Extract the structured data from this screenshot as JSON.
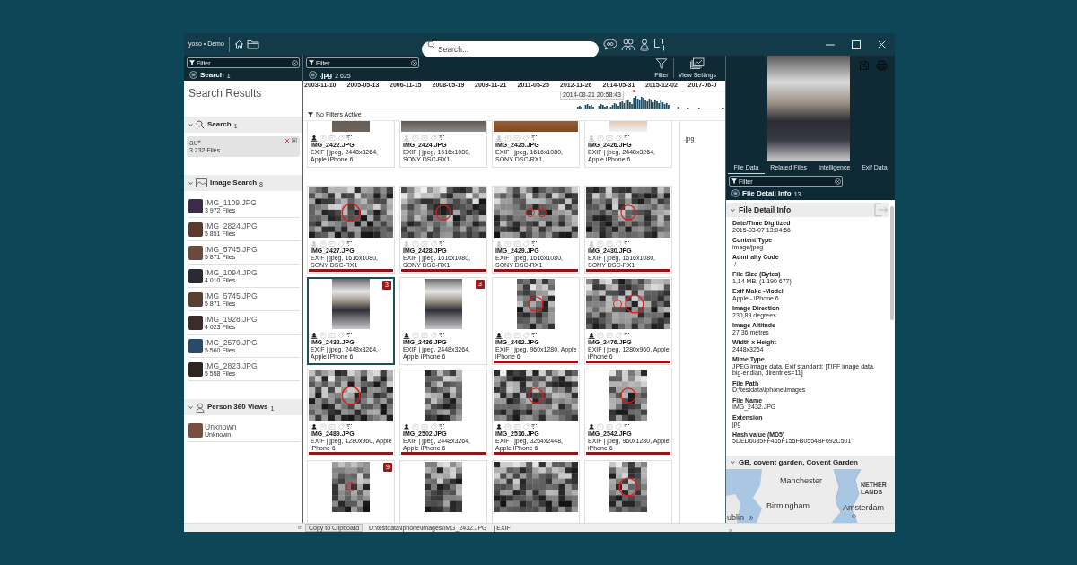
{
  "window": {
    "logo": "yoso • Demo",
    "search_placeholder": "Search..."
  },
  "search_panel": {
    "filter_placeholder": "Filter",
    "header": {
      "title": "Search",
      "count": "1"
    },
    "heading": "Search Results",
    "sections": [
      {
        "kind": "search",
        "title": "Search",
        "count": "1",
        "expanded": true,
        "items": [
          {
            "title": "au*",
            "subtitle": "3 232 Files",
            "selected": true
          }
        ]
      },
      {
        "kind": "image",
        "title": "Image Search",
        "count": "8",
        "expanded": true,
        "items": [
          {
            "title": "IMG_1109.JPG",
            "subtitle": "3 972 Files",
            "selected": false
          },
          {
            "title": "IMG_2824.JPG",
            "subtitle": "5 851 Files",
            "selected": false
          },
          {
            "title": "IMG_5745.JPG",
            "subtitle": "5 871 Files",
            "selected": false
          },
          {
            "title": "IMG_1094.JPG",
            "subtitle": "4 010 Files",
            "selected": false
          },
          {
            "title": "IMG_5745.JPG",
            "subtitle": "5 871 Files",
            "selected": false
          },
          {
            "title": "IMG_1928.JPG",
            "subtitle": "4 023 Files",
            "selected": false
          },
          {
            "title": "IMG_2579.JPG",
            "subtitle": "5 560 Files",
            "selected": false
          },
          {
            "title": "IMG_2823.JPG",
            "subtitle": "5 558 Files",
            "selected": false
          }
        ]
      },
      {
        "kind": "person",
        "title": "Person 360 Views",
        "count": "1",
        "expanded": true,
        "items": [
          {
            "title": "Unknown",
            "subtitle": "Unknown",
            "selected": false
          }
        ]
      }
    ]
  },
  "results_panel": {
    "filter_placeholder": "Filter",
    "header": {
      "title": ".jpg",
      "count": "2 625"
    },
    "tools": [
      {
        "kind": "filter",
        "label": "Filter"
      },
      {
        "kind": "view_settings",
        "label": "View Settings"
      }
    ],
    "timeline": {
      "dates": [
        "2003-11-10",
        "2005-05-13",
        "2006-11-15",
        "2008-05-19",
        "2009-11-21",
        "2011-05-25",
        "2012-11-26",
        "2014-05-31",
        "2015-12-02",
        "2017-06-0"
      ],
      "tooltip": "2014-08-21 20:58:43"
    },
    "filter_status": "No Filters Active",
    "cards": [
      {
        "name": "IMG_2422.JPG",
        "exif": "EXIF | jpeg, 2448x3264, Apple iPhone 6",
        "kind": "photo",
        "person_tagged": true,
        "flagged": false,
        "selected": false
      },
      {
        "name": "IMG_2424.JPG",
        "exif": "EXIF | jpeg, 1616x1080, SONY DSC-RX1",
        "kind": "photo",
        "person_tagged": false,
        "flagged": false,
        "selected": false
      },
      {
        "name": "IMG_2425.JPG",
        "exif": "EXIF | jpeg, 1616x1080, SONY DSC-RX1",
        "kind": "photo",
        "person_tagged": false,
        "flagged": false,
        "selected": false
      },
      {
        "name": "IMG_2426.JPG",
        "exif": "EXIF | jpeg, 2448x3264, Apple iPhone 6",
        "kind": "photo",
        "person_tagged": false,
        "flagged": false,
        "selected": false
      },
      {
        "name": "IMG_2427.JPG",
        "exif": "EXIF | jpeg, 1616x1080, SONY DSC-RX1",
        "kind": "pixelated",
        "person_tagged": false,
        "flagged": true,
        "selected": false,
        "faces": [
          {
            "kind": "large"
          }
        ]
      },
      {
        "name": "IMG_2428.JPG",
        "exif": "EXIF | jpeg, 1616x1080, SONY DSC-RX1",
        "kind": "pixelated",
        "person_tagged": false,
        "flagged": true,
        "selected": false,
        "faces": [
          {
            "kind": "medium"
          }
        ]
      },
      {
        "name": "IMG_2429.JPG",
        "exif": "EXIF | jpeg, 1616x1080, SONY DSC-RX1",
        "kind": "pixelated",
        "person_tagged": false,
        "flagged": true,
        "selected": false,
        "faces": [
          {
            "kind": "small"
          },
          {
            "kind": "small"
          }
        ]
      },
      {
        "name": "IMG_2430.JPG",
        "exif": "EXIF | jpeg, 1616x1080, SONY DSC-RX1",
        "kind": "pixelated",
        "person_tagged": false,
        "flagged": true,
        "selected": false,
        "faces": [
          {
            "kind": "medium"
          }
        ]
      },
      {
        "name": "IMG_2432.JPG",
        "exif": "EXIF | jpeg, 2448x3264, Apple iPhone 6",
        "kind": "photo",
        "person_tagged": true,
        "flagged": false,
        "selected": true,
        "badge": "3"
      },
      {
        "name": "IMG_2436.JPG",
        "exif": "EXIF | jpeg, 2448x3264, Apple iPhone 6",
        "kind": "photo",
        "person_tagged": true,
        "flagged": false,
        "selected": false,
        "badge": "3"
      },
      {
        "name": "IMG_2462.JPG",
        "exif": "EXIF | jpeg, 960x1280, Apple iPhone 6",
        "kind": "pixelated",
        "person_tagged": true,
        "flagged": true,
        "selected": false,
        "faces": [
          {
            "kind": "medium"
          }
        ]
      },
      {
        "name": "IMG_2476.JPG",
        "exif": "EXIF | jpeg, 1280x960, Apple iPhone 6",
        "kind": "pixelated",
        "person_tagged": true,
        "flagged": true,
        "selected": false,
        "faces": [
          {
            "kind": "small"
          },
          {
            "kind": "large"
          }
        ]
      },
      {
        "name": "IMG_2489.JPG",
        "exif": "EXIF | jpeg, 1280x960, Apple iPhone 6",
        "kind": "pixelated",
        "person_tagged": true,
        "flagged": true,
        "selected": false,
        "faces": [
          {
            "kind": "large"
          }
        ]
      },
      {
        "name": "IMG_2502.JPG",
        "exif": "EXIF | jpeg, 2448x3264, Apple iPhone 6",
        "kind": "pixelated",
        "person_tagged": true,
        "flagged": true,
        "selected": false
      },
      {
        "name": "IMG_2516.JPG",
        "exif": "EXIF | jpeg, 3264x2448, Apple iPhone 6",
        "kind": "pixelated",
        "person_tagged": true,
        "flagged": true,
        "selected": false,
        "faces": [
          {
            "kind": "medium"
          }
        ]
      },
      {
        "name": "IMG_2542.JPG",
        "exif": "EXIF | jpeg, 960x1280, Apple iPhone 6",
        "kind": "pixelated",
        "person_tagged": true,
        "flagged": true,
        "selected": false,
        "faces": [
          {
            "kind": "medium"
          }
        ]
      },
      {
        "kind": "pixelated",
        "selected": false,
        "badge": "9",
        "faces": [
          {
            "kind": "small"
          }
        ]
      },
      {
        "kind": "pixelated",
        "selected": false
      },
      {
        "kind": "pixelated",
        "selected": false
      },
      {
        "kind": "pixelated",
        "selected": false,
        "faces": [
          {
            "kind": "large"
          }
        ]
      }
    ],
    "side_group": ".jpg"
  },
  "detail_panel": {
    "tabs": [
      {
        "label": "File Data",
        "selected": true
      },
      {
        "label": "Related Files",
        "selected": false
      },
      {
        "label": "Intelligence",
        "selected": false
      },
      {
        "label": "Exif Data",
        "selected": false
      }
    ],
    "filter_placeholder": "Filter",
    "header": {
      "title": "File Detail Info",
      "count": "13"
    },
    "info_section": {
      "title": "File Detail Info",
      "expanded": true,
      "fields": [
        {
          "label": "Date/Time Digitized",
          "value": "2015-03-07 13:04:56"
        },
        {
          "label": "Content Type",
          "value": "image/jpeg"
        },
        {
          "label": "Admiralty Code",
          "value": "-/-"
        },
        {
          "label": "File Size (Bytes)",
          "value": "1,14 MB, (1 190 677)"
        },
        {
          "label": "Exif Make -Model",
          "value": "Apple - iPhone 6"
        },
        {
          "label": "Image Direction",
          "value": "230,89 degrees"
        },
        {
          "label": "Image Altitude",
          "value": "27,36 metres"
        },
        {
          "label": "Width x Height",
          "value": "2448x3264"
        },
        {
          "label": "Mime Type",
          "value": "JPEG image data, Exif standard: [TIFF image data, big-endian, direntries=11]"
        },
        {
          "label": "File Path",
          "value": "D:\\testdata\\iphone\\images"
        },
        {
          "label": "File Name",
          "value": "IMG_2432.JPG"
        },
        {
          "label": "Extension",
          "value": "jpg"
        },
        {
          "label": "Hash value (MD5)",
          "value": "5DED6085FF465F155FB0554BF692C501"
        }
      ]
    },
    "location_section": {
      "title": "GB, covent garden, Covent Garden",
      "expanded": true,
      "map_labels": [
        "Manchester",
        "NETHER LANDS",
        "ublin",
        "Birmingham",
        "Amsterdam"
      ]
    }
  },
  "status_bar": {
    "collapse_left": "«",
    "copy_button": "Copy to Clipboard",
    "path": "D:\\testdata\\iphone\\images\\IMG_2432.JPG",
    "info": "| EXIF",
    "collapse_right": "»"
  }
}
